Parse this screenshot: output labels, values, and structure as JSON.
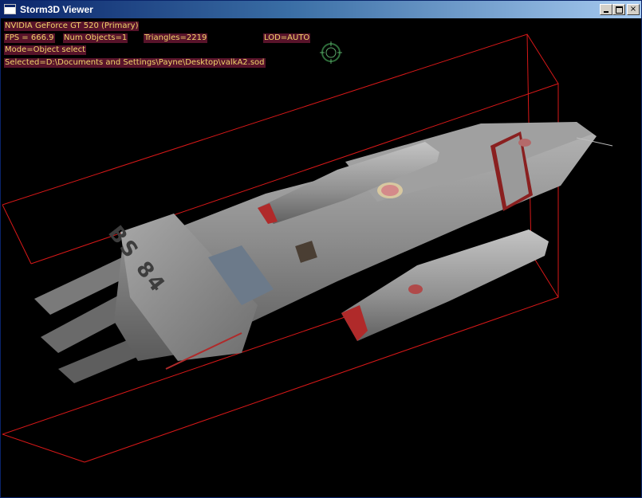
{
  "window": {
    "title": "Storm3D Viewer",
    "minimize_glyph": "_",
    "maximize_glyph": "□",
    "close_glyph": "×"
  },
  "hud": {
    "adapter": "NVIDIA GeForce GT 520  (Primary)",
    "fps": "FPS = 666.9",
    "num_objects": "Num Objects=1",
    "triangles": "Triangles=2219",
    "lod": "LOD=AUTO",
    "mode": "Mode=Object select",
    "selected": "Selected=D:\\Documents and Settings\\Payne\\Desktop\\valkA2.sod"
  },
  "ship": {
    "hull_text": "BS 84",
    "colors": {
      "hull": "#8f8f8f",
      "hull_dark": "#5d5d5d",
      "accent": "#b02a2a",
      "bbox": "#d81818"
    }
  },
  "icons": {
    "title_icon": "app-window-icon",
    "crosshair": "target-reticle-icon"
  }
}
